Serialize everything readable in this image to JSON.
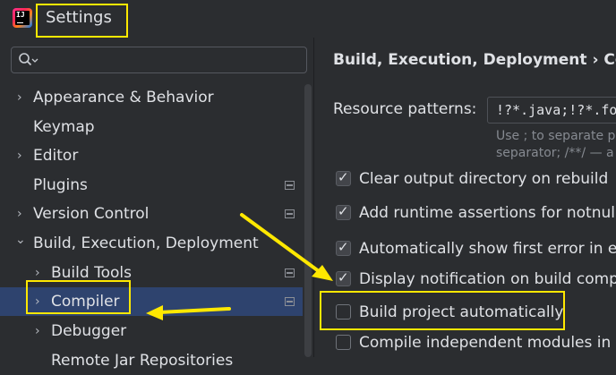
{
  "window": {
    "title": "Settings"
  },
  "search": {
    "placeholder": ""
  },
  "sidebar": {
    "items": [
      {
        "label": "Appearance & Behavior",
        "chevron": "›",
        "has_icon": false
      },
      {
        "label": "Keymap",
        "chevron": "",
        "has_icon": false
      },
      {
        "label": "Editor",
        "chevron": "›",
        "has_icon": false
      },
      {
        "label": "Plugins",
        "chevron": "",
        "has_icon": true
      },
      {
        "label": "Version Control",
        "chevron": "›",
        "has_icon": true
      },
      {
        "label": "Build, Execution, Deployment",
        "chevron": "⌄",
        "has_icon": false
      },
      {
        "label": "Build Tools",
        "chevron": "›",
        "has_icon": true
      },
      {
        "label": "Compiler",
        "chevron": "›",
        "has_icon": true,
        "selected": true
      },
      {
        "label": "Debugger",
        "chevron": "›",
        "has_icon": false
      },
      {
        "label": "Remote Jar Repositories",
        "chevron": "",
        "has_icon": false
      }
    ]
  },
  "main": {
    "breadcrumb": "Build, Execution, Deployment  ›  Co",
    "resource_patterns": {
      "label": "Resource patterns:",
      "value": "!?*.java;!?*.fo",
      "hint_line1": "Use ; to separate p",
      "hint_line2": "separator; /**/ — a"
    },
    "options": [
      {
        "label": "Clear output directory on rebuild",
        "checked": true
      },
      {
        "label": "Add runtime assertions for notnull-a",
        "checked": true
      },
      {
        "label": "Automatically show first error in ed",
        "checked": true
      },
      {
        "label": "Display notification on build comple",
        "checked": true
      },
      {
        "label": "Build project automatically",
        "checked": false
      },
      {
        "label": "Compile independent modules in pa",
        "checked": false
      }
    ]
  },
  "colors": {
    "accent": "#2e436e",
    "highlight": "#ffe800",
    "background": "#2b2d30"
  }
}
